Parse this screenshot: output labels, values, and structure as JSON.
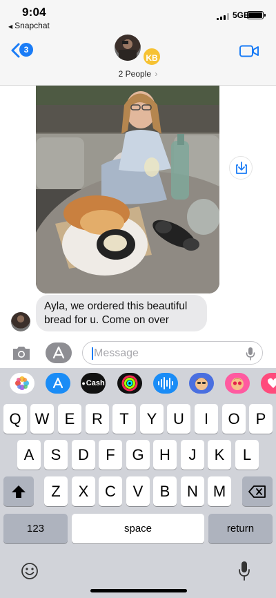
{
  "status_bar": {
    "time": "9:04",
    "back_app": "Snapchat",
    "network": "5GE"
  },
  "header": {
    "unread_count": "3",
    "kb_initials": "KB",
    "title": "2 People",
    "title_arrow": "›"
  },
  "message": {
    "text_line1": "Ayla, we ordered this beautiful",
    "text_line2": "bread for u. Come on over"
  },
  "composer": {
    "placeholder": "Message"
  },
  "app_strip": {
    "cash_label": "Cash"
  },
  "keyboard": {
    "row1": [
      "Q",
      "W",
      "E",
      "R",
      "T",
      "Y",
      "U",
      "I",
      "O",
      "P"
    ],
    "row2": [
      "A",
      "S",
      "D",
      "F",
      "G",
      "H",
      "J",
      "K",
      "L"
    ],
    "row3": [
      "Z",
      "X",
      "C",
      "V",
      "B",
      "N",
      "M"
    ],
    "numbers_key": "123",
    "space_key": "space",
    "return_key": "return"
  },
  "colors": {
    "accent": "#1a7cf6",
    "kb_badge": "#f6c233",
    "bubble": "#e9e9eb",
    "keyboard_bg": "#d1d3d9"
  }
}
